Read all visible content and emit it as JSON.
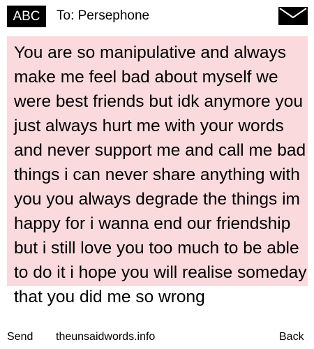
{
  "header": {
    "input_mode": "ABC",
    "recipient": "To: Persephone",
    "icon": "envelope-icon"
  },
  "message": {
    "text": "You are so manipulative and always make me feel bad about myself we were best friends but idk anymore you just always hurt me with your words and never support me and call me bad things i can never share anything with you you always degrade the things im happy for i wanna end our friendship but i still love you too much to be able to do it i hope you will realise someday that you did me so wrong",
    "background": "#fadadd"
  },
  "softkeys": {
    "left": "Send",
    "center": "theunsaidwords.info",
    "right": "Back"
  }
}
